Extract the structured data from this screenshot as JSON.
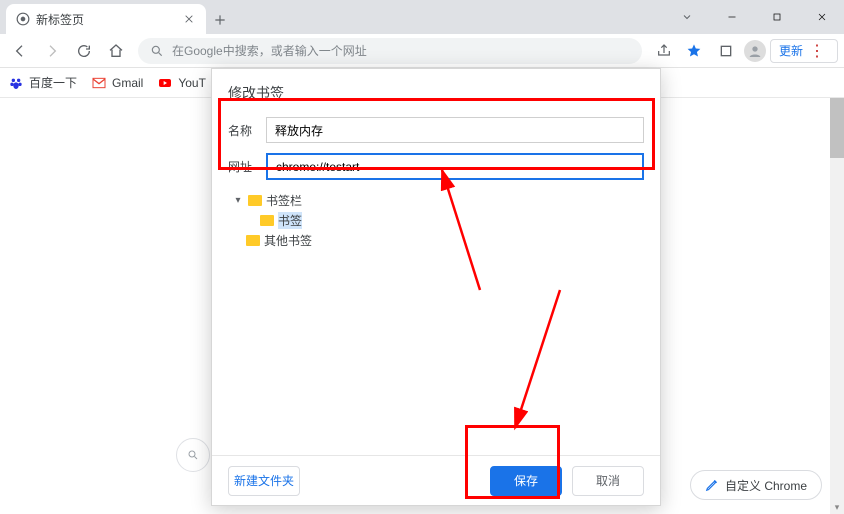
{
  "tab": {
    "title": "新标签页"
  },
  "omnibox": {
    "placeholder": "在Google中搜索，或者输入一个网址"
  },
  "toolbar_right": {
    "update": "更新"
  },
  "bookmarks_bar": {
    "items": [
      {
        "label": "百度一下"
      },
      {
        "label": "Gmail"
      },
      {
        "label": "YouT"
      }
    ]
  },
  "dialog": {
    "title": "修改书签",
    "name_label": "名称",
    "name_value": "释放内存",
    "url_label": "网址",
    "url_value": "chrome://testart",
    "tree": {
      "root_label": "书签栏",
      "child_label": "书签",
      "other_label": "其他书签"
    },
    "footer": {
      "new_folder": "新建文件夹",
      "save": "保存",
      "cancel": "取消"
    }
  },
  "customize": {
    "label": "自定义 Chrome"
  }
}
